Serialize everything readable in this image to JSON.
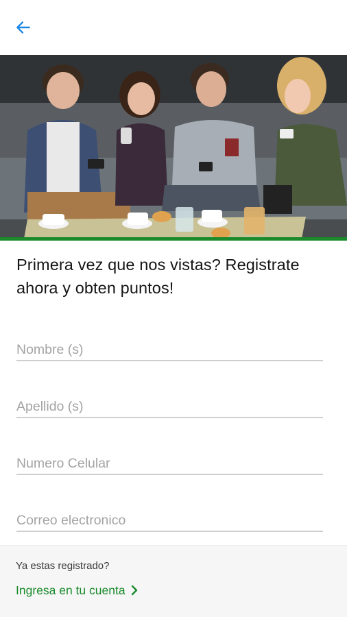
{
  "colors": {
    "accent_blue": "#1e88e5",
    "brand_green": "#178a2a",
    "hero_bar": "#1b8a2b"
  },
  "header": {
    "back_icon": "arrow-left-icon"
  },
  "hero": {
    "image_label": "hero-photo"
  },
  "headline": "Primera vez que nos vistas? Registrate ahora y obten puntos!",
  "form": {
    "first_name": {
      "placeholder": "Nombre (s)",
      "value": ""
    },
    "last_name": {
      "placeholder": "Apellido (s)",
      "value": ""
    },
    "phone": {
      "placeholder": "Numero Celular",
      "value": ""
    },
    "email": {
      "placeholder": "Correo electronico",
      "value": ""
    }
  },
  "footer": {
    "question": "Ya estas registrado?",
    "login_link": "Ingresa en tu cuenta",
    "link_icon": "chevron-right-icon"
  }
}
